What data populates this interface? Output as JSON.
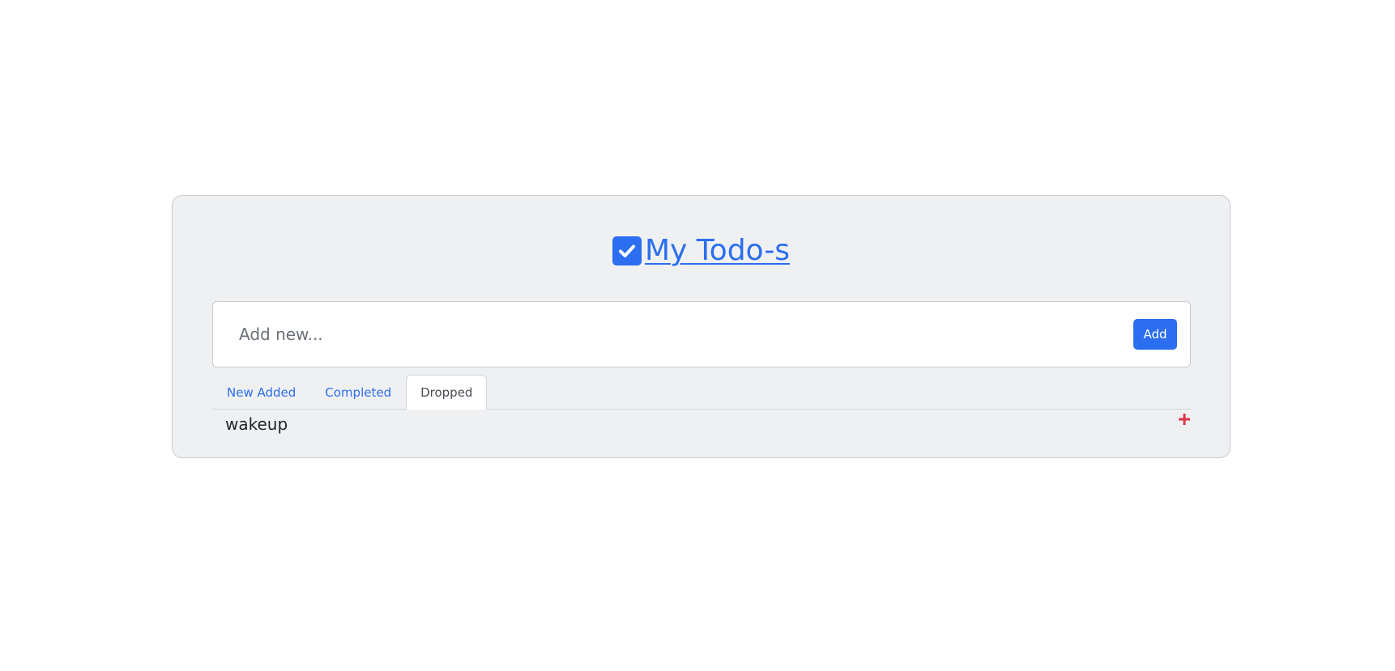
{
  "header": {
    "title": "My Todo-s",
    "icon": "checkbox-checked-icon",
    "accent_color": "#2c6ef0"
  },
  "add_form": {
    "placeholder": "Add new...",
    "value": "",
    "button_label": "Add"
  },
  "tabs": [
    {
      "label": "New Added",
      "active": false
    },
    {
      "label": "Completed",
      "active": false
    },
    {
      "label": "Dropped",
      "active": true
    }
  ],
  "todos": [
    {
      "text": "wakeup",
      "action_icon": "plus-icon",
      "action_color": "#dc3545"
    }
  ]
}
